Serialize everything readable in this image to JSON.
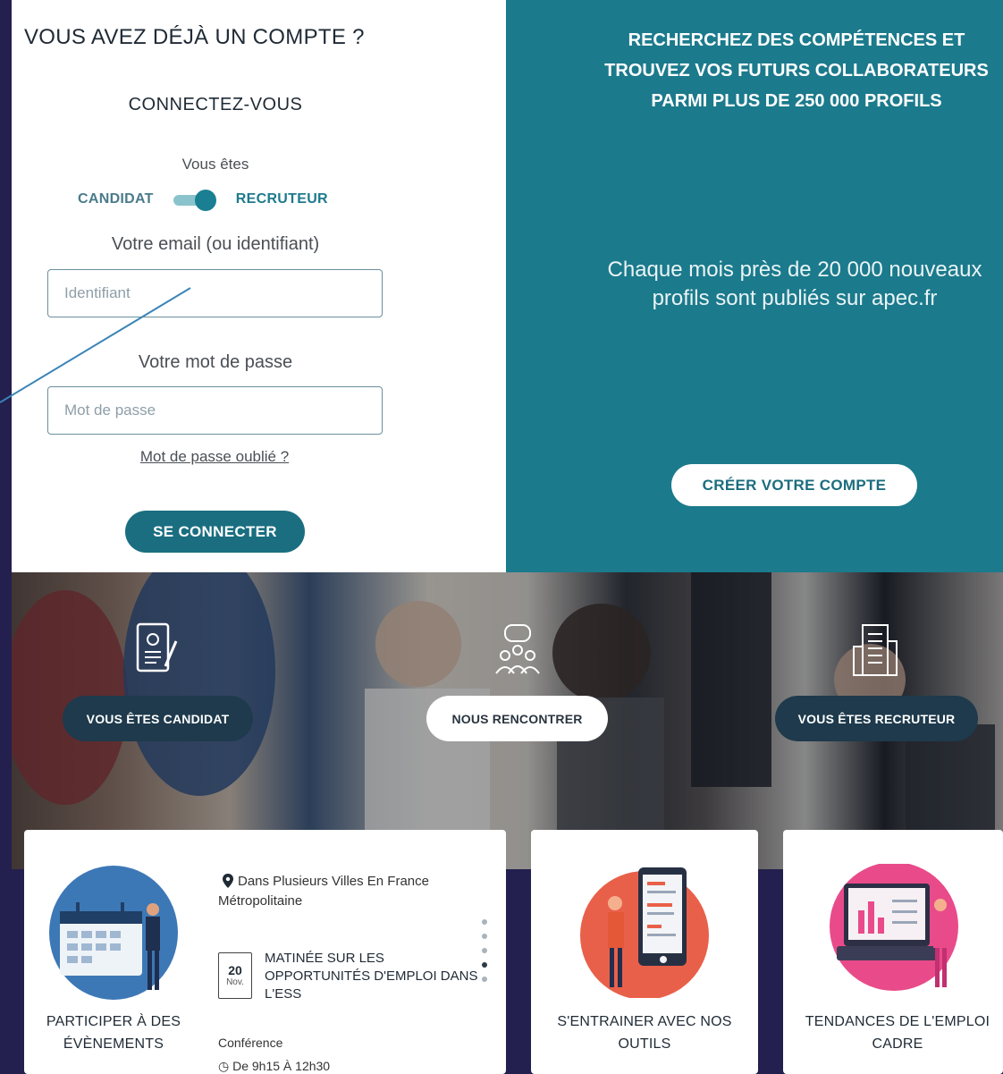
{
  "login": {
    "title": "VOUS AVEZ DÉJÀ UN COMPTE ?",
    "subtitle": "CONNECTEZ-VOUS",
    "you_are": "Vous êtes",
    "role_candidate": "CANDIDAT",
    "role_recruiter": "RECRUTEUR",
    "toggle_state": "RECRUTEUR",
    "email_label": "Votre email (ou identifiant)",
    "email_placeholder": "Identifiant",
    "password_label": "Votre mot de passe",
    "password_placeholder": "Mot de passe",
    "forgot": "Mot de passe oublié ?",
    "submit": "SE CONNECTER"
  },
  "promo": {
    "title": "RECHERCHEZ DES COMPÉTENCES ET TROUVEZ VOS FUTURS COLLABORATEURS PARMI PLUS DE 250 000 PROFILS",
    "text": "Chaque mois près de 20 000 nouveaux profils sont publiés sur apec.fr",
    "cta": "CRÉER VOTRE COMPTE"
  },
  "band": {
    "candidate_cta": "VOUS ÊTES CANDIDAT",
    "meet_cta": "NOUS RENCONTRER",
    "recruiter_cta": "VOUS ÊTES RECRUTEUR"
  },
  "cards": {
    "events": {
      "title": "PARTICIPER À DES ÉVÈNEMENTS",
      "location": "Dans Plusieurs Villes En France Métropolitaine",
      "date_day": "20",
      "date_month": "Nov.",
      "event_title": "MATINÉE SUR LES OPPORTUNITÉS D'EMPLOI DANS L'ESS",
      "event_type": "Conférence",
      "event_time": "De 9h15 À 12h30"
    },
    "tools": {
      "title": "S'ENTRAINER AVEC NOS OUTILS"
    },
    "trends": {
      "title": "TENDANCES DE L'EMPLOI CADRE"
    }
  },
  "colors": {
    "navy": "#231f4e",
    "teal": "#1b7a8c",
    "button": "#1a6e80"
  }
}
